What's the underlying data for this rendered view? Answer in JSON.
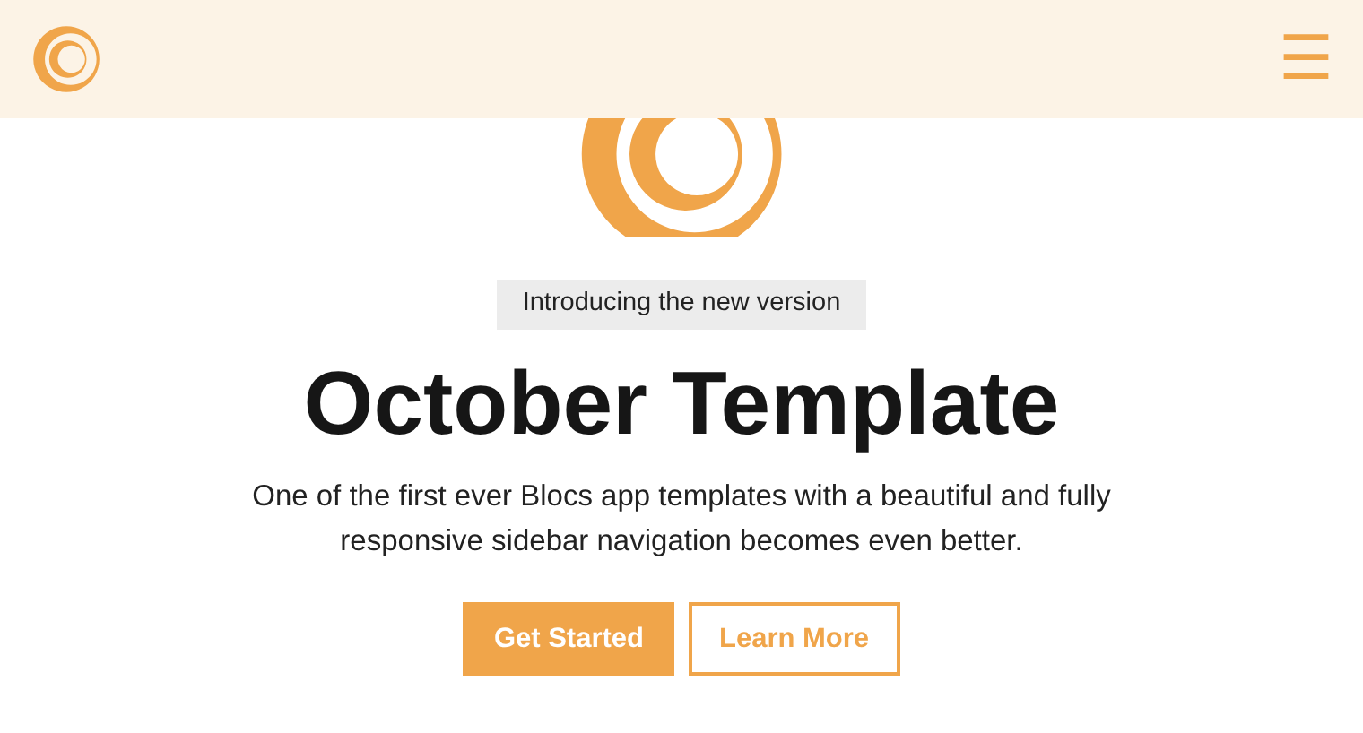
{
  "navbar": {
    "menu_label": "☰"
  },
  "hero": {
    "badge": "Introducing the new version",
    "title": "October Template",
    "description": "One of the first ever Blocs app templates with a beautiful and fully responsive sidebar navigation becomes even better.",
    "buttons": [
      {
        "label": "Get Started",
        "kind": "primary"
      },
      {
        "label": "Learn More",
        "kind": "outline"
      }
    ]
  }
}
